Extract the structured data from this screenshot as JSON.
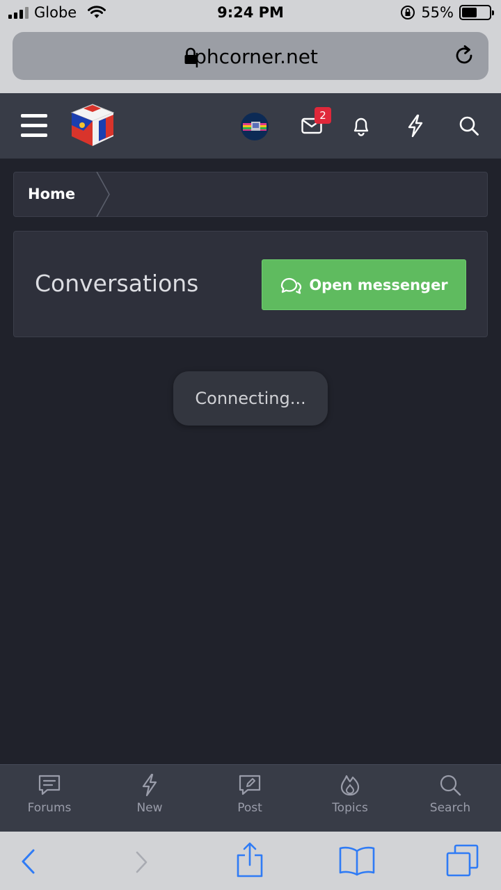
{
  "status_bar": {
    "carrier": "Globe",
    "time": "9:24 PM",
    "battery_percent": "55%",
    "battery_level": 0.55
  },
  "browser": {
    "url": "phcorner.net"
  },
  "header": {
    "messages_badge": "2"
  },
  "breadcrumb": {
    "home": "Home"
  },
  "conversations": {
    "title": "Conversations",
    "open_messenger_label": "Open messenger"
  },
  "toast": {
    "text": "Connecting..."
  },
  "bottom_nav": {
    "forums": "Forums",
    "new": "New",
    "post": "Post",
    "topics": "Topics",
    "search": "Search"
  },
  "colors": {
    "accent_green": "#5fbb5f",
    "badge_red": "#e0283a",
    "header_bg": "#383c47",
    "page_bg": "#20222b",
    "safari_blue": "#2f7bf5"
  }
}
